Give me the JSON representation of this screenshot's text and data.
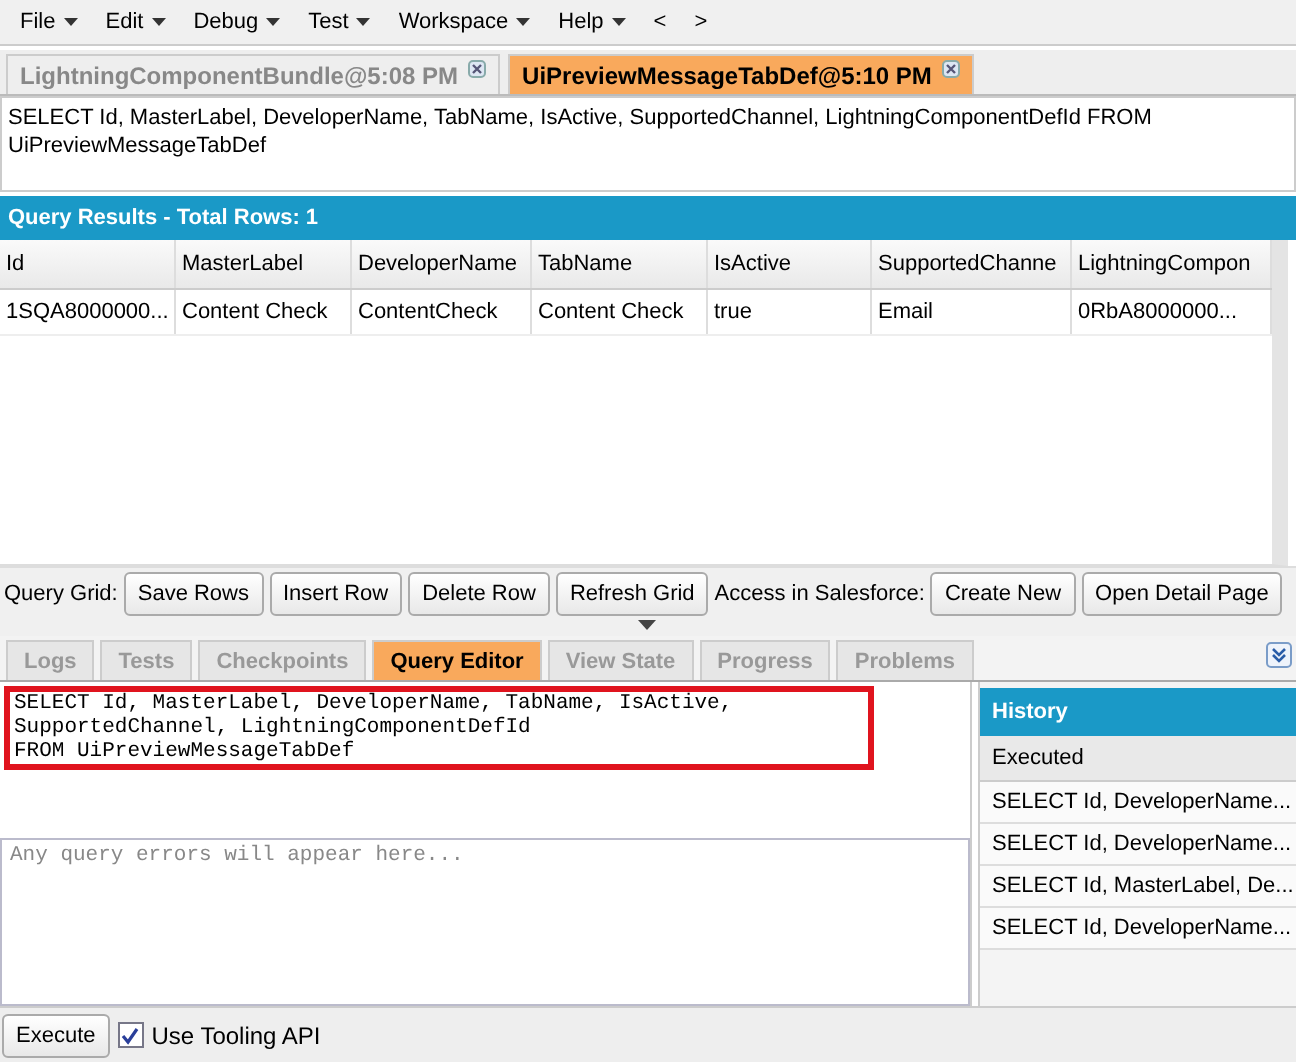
{
  "menu": [
    {
      "label": "File",
      "caret": true
    },
    {
      "label": "Edit",
      "caret": true
    },
    {
      "label": "Debug",
      "caret": true
    },
    {
      "label": "Test",
      "caret": true
    },
    {
      "label": "Workspace",
      "caret": true
    },
    {
      "label": "Help",
      "caret": true
    },
    {
      "label": "<",
      "caret": false
    },
    {
      "label": ">",
      "caret": false
    }
  ],
  "file_tabs": [
    {
      "label": "LightningComponentBundle@5:08 PM",
      "selected": false
    },
    {
      "label": "UiPreviewMessageTabDef@5:10 PM",
      "selected": true
    }
  ],
  "query_text": "SELECT Id, MasterLabel, DeveloperName, TabName, IsActive, SupportedChannel, LightningComponentDefId FROM UiPreviewMessageTabDef",
  "results": {
    "title": "Query Results - Total Rows: 1",
    "columns": [
      "Id",
      "MasterLabel",
      "DeveloperName",
      "TabName",
      "IsActive",
      "SupportedChanne",
      "LightningCompon"
    ],
    "rows": [
      [
        "1SQA8000000...",
        "Content Check",
        "ContentCheck",
        "Content Check",
        "true",
        "Email",
        "0RbA8000000..."
      ]
    ]
  },
  "toolbar": {
    "grid_label": "Query Grid:",
    "grid_buttons": [
      "Save Rows",
      "Insert Row",
      "Delete Row",
      "Refresh Grid"
    ],
    "sf_label": "Access in Salesforce:",
    "sf_buttons": [
      "Create New",
      "Open Detail Page"
    ]
  },
  "panel_tabs": [
    {
      "label": "Logs",
      "selected": false
    },
    {
      "label": "Tests",
      "selected": false
    },
    {
      "label": "Checkpoints",
      "selected": false
    },
    {
      "label": "Query Editor",
      "selected": true
    },
    {
      "label": "View State",
      "selected": false
    },
    {
      "label": "Progress",
      "selected": false
    },
    {
      "label": "Problems",
      "selected": false
    }
  ],
  "editor": {
    "value": "SELECT Id, MasterLabel, DeveloperName, TabName, IsActive,\nSupportedChannel, LightningComponentDefId\nFROM UiPreviewMessageTabDef",
    "highlighted": true
  },
  "errors": {
    "placeholder": "Any query errors will appear here..."
  },
  "history": {
    "title": "History",
    "column": "Executed",
    "items": [
      "SELECT Id, DeveloperName...",
      "SELECT Id, DeveloperName...",
      "SELECT Id, MasterLabel, De...",
      "SELECT Id, DeveloperName..."
    ]
  },
  "execute_button": "Execute",
  "tooling": {
    "label": "Use Tooling API",
    "checked": true
  }
}
